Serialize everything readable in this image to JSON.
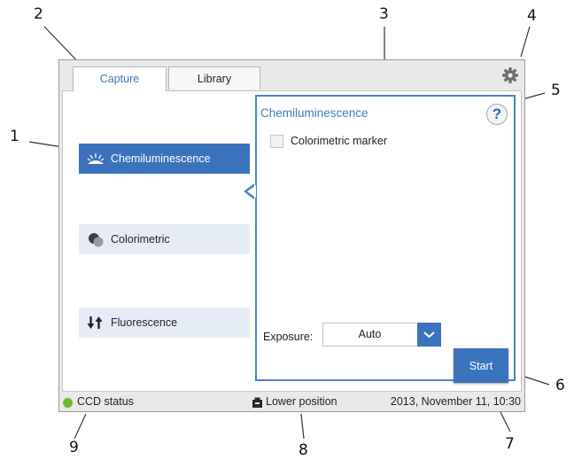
{
  "callouts": [
    "1",
    "2",
    "3",
    "4",
    "5",
    "6",
    "7",
    "8",
    "9"
  ],
  "tabs": {
    "capture": "Capture",
    "library": "Library"
  },
  "modes": {
    "chemiluminescence": "Chemiluminescence",
    "colorimetric": "Colorimetric",
    "fluorescence": "Fluorescence"
  },
  "panel": {
    "title": "Chemiluminescence",
    "help": "?",
    "colorimetric_marker": "Colorimetric marker",
    "colorimetric_marker_checked": false,
    "exposure_label": "Exposure:",
    "exposure_value": "Auto",
    "start": "Start"
  },
  "status": {
    "ccd": "CCD status",
    "position": "Lower position",
    "datetime": "2013, November 11, 10:30"
  },
  "colors": {
    "accent": "#3a73bb",
    "panel_border": "#4a82c8",
    "status_ok": "#6dbb2f",
    "inactive_mode_bg": "#e6ecf5"
  },
  "icons": {
    "settings": "gear-icon",
    "help": "question-icon",
    "chemiluminescence": "glow-icon",
    "colorimetric": "overlapping-circles-icon",
    "fluorescence": "up-down-arrows-icon",
    "exposure_dropdown": "chevron-down-icon",
    "position": "tray-icon",
    "ccd_status": "status-dot-icon"
  }
}
